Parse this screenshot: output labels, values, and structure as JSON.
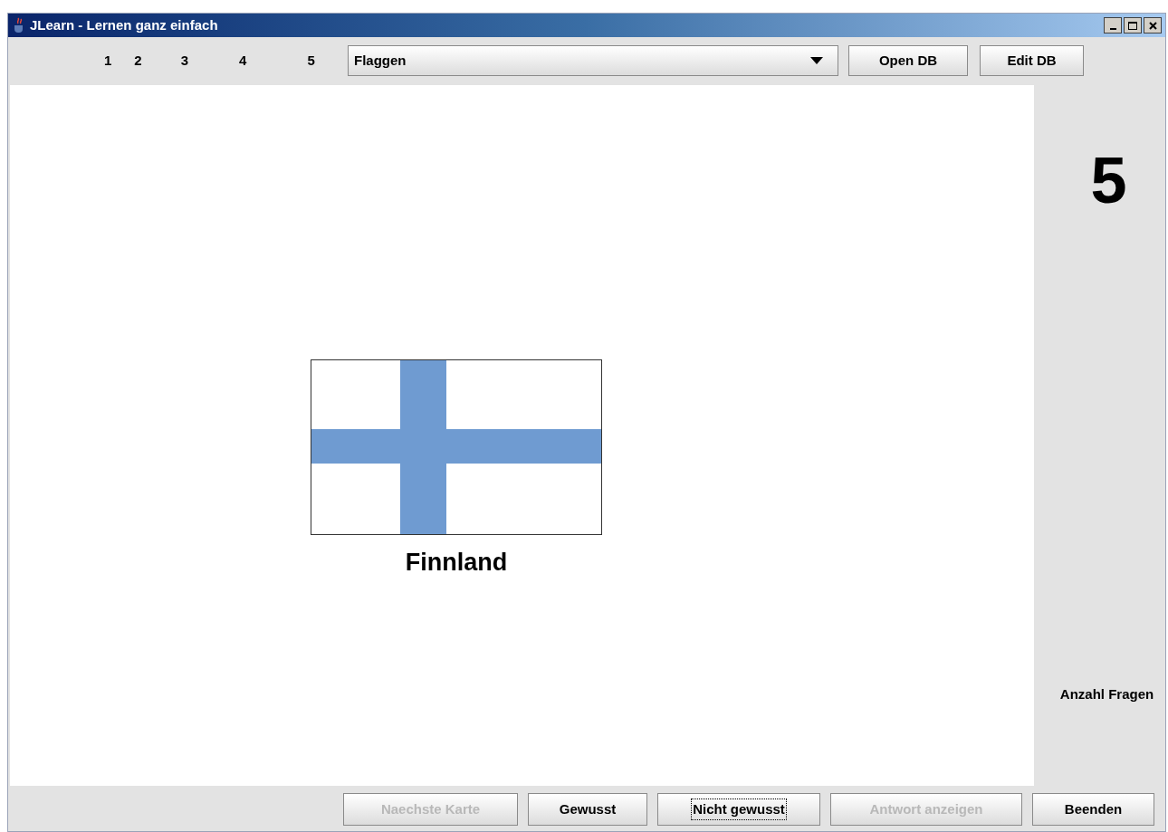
{
  "window": {
    "title": "JLearn - Lernen ganz einfach"
  },
  "levels": [
    "1",
    "2",
    "3",
    "4",
    "5"
  ],
  "category": {
    "value": "Flaggen"
  },
  "top_buttons": [
    {
      "label": "Open DB",
      "disabled": false
    },
    {
      "label": "Edit DB",
      "disabled": false
    }
  ],
  "card": {
    "answer": "Finnland"
  },
  "side": {
    "count": "5",
    "count_label": "Anzahl Fragen"
  },
  "bottom_buttons": [
    {
      "label": "Naechste Karte",
      "disabled": true,
      "focused": false
    },
    {
      "label": "Gewusst",
      "disabled": false,
      "focused": false
    },
    {
      "label": "Nicht gewusst",
      "disabled": false,
      "focused": true
    },
    {
      "label": "Antwort anzeigen",
      "disabled": true,
      "focused": false
    },
    {
      "label": "Beenden",
      "disabled": false,
      "focused": false
    }
  ]
}
